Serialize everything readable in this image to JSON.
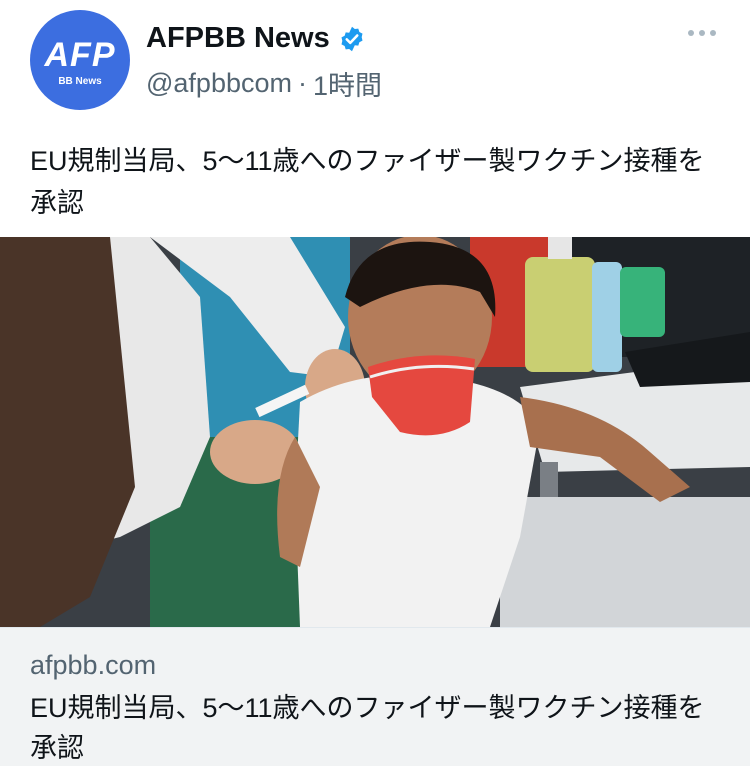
{
  "account": {
    "avatar_logo": "AFP",
    "avatar_sub": "BB News",
    "name": "AFPBB News",
    "handle": "@afpbbcom",
    "separator": "·",
    "time": "1時間"
  },
  "tweet": {
    "text": "EU規制当局、5〜11歳へのファイザー製ワクチン接種を承認"
  },
  "link_card": {
    "domain": "afpbb.com",
    "title": "EU規制当局、5〜11歳へのファイザー製ワクチン接種を承認"
  },
  "colors": {
    "avatar_bg": "#3c6ee0",
    "verified": "#1d9bf0",
    "mask": "#e5483f"
  },
  "icons": {
    "verified": "verified-badge-icon",
    "more": "more-horizontal-icon"
  }
}
